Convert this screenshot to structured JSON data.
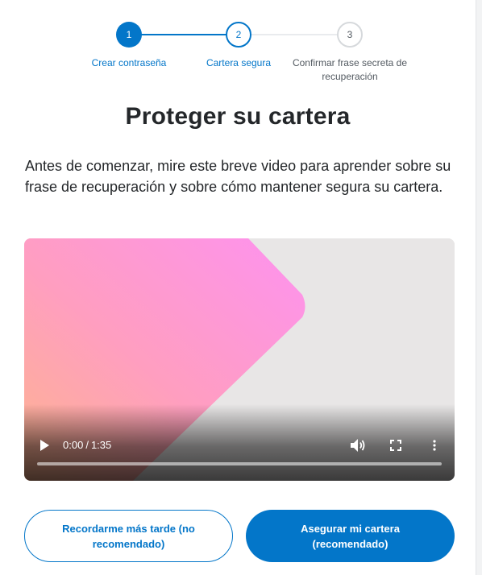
{
  "stepper": {
    "steps": [
      {
        "number": "1",
        "label": "Crear contraseña",
        "state": "complete"
      },
      {
        "number": "2",
        "label": "Cartera segura",
        "state": "active"
      },
      {
        "number": "3",
        "label": "Confirmar frase secreta de recuperación",
        "state": "pending"
      }
    ]
  },
  "page": {
    "title": "Proteger su cartera",
    "intro": "Antes de comenzar, mire este breve video para aprender sobre su frase de recuperación y sobre cómo mantener segura su cartera."
  },
  "video": {
    "current_time": "0:00",
    "duration": "1:35",
    "progress": 0,
    "icons": {
      "play": "play-icon",
      "volume": "volume-icon",
      "fullscreen": "fullscreen-icon",
      "more": "more-options-icon"
    }
  },
  "actions": {
    "remind_later_label": "Recordarme más tarde (no recomendado)",
    "secure_wallet_label": "Asegurar mi cartera (recomendado)"
  },
  "colors": {
    "primary": "#0376c9",
    "text": "#24272a",
    "muted": "#535a61",
    "inactive_line": "#e9ebee"
  }
}
